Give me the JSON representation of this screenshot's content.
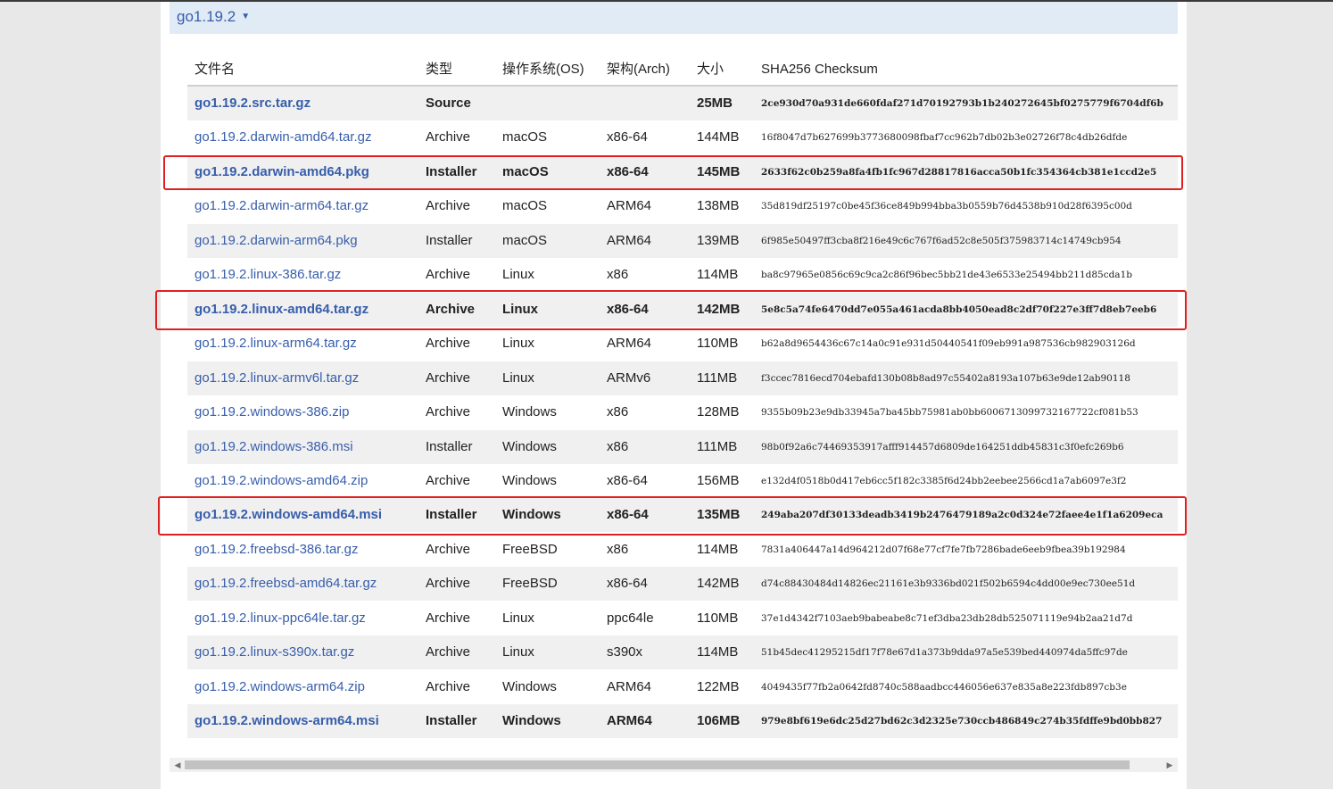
{
  "version": {
    "label": "go1.19.2",
    "caret": "▼"
  },
  "headers": {
    "file": "文件名",
    "type": "类型",
    "os": "操作系统(OS)",
    "arch": "架构(Arch)",
    "size": "大小",
    "checksum": "SHA256 Checksum"
  },
  "rows": [
    {
      "file": "go1.19.2.src.tar.gz",
      "type": "Source",
      "os": "",
      "arch": "",
      "size": "25MB",
      "checksum": "2ce930d70a931de660fdaf271d70192793b1b240272645bf0275779f6704df6b",
      "bold": true
    },
    {
      "file": "go1.19.2.darwin-amd64.tar.gz",
      "type": "Archive",
      "os": "macOS",
      "arch": "x86-64",
      "size": "144MB",
      "checksum": "16f8047d7b627699b3773680098fbaf7cc962b7db02b3e02726f78c4db26dfde",
      "bold": false
    },
    {
      "file": "go1.19.2.darwin-amd64.pkg",
      "type": "Installer",
      "os": "macOS",
      "arch": "x86-64",
      "size": "145MB",
      "checksum": "2633f62c0b259a8fa4fb1fc967d28817816acca50b1fc354364cb381e1ccd2e5",
      "bold": true
    },
    {
      "file": "go1.19.2.darwin-arm64.tar.gz",
      "type": "Archive",
      "os": "macOS",
      "arch": "ARM64",
      "size": "138MB",
      "checksum": "35d819df25197c0be45f36ce849b994bba3b0559b76d4538b910d28f6395c00d",
      "bold": false
    },
    {
      "file": "go1.19.2.darwin-arm64.pkg",
      "type": "Installer",
      "os": "macOS",
      "arch": "ARM64",
      "size": "139MB",
      "checksum": "6f985e50497ff3cba8f216e49c6c767f6ad52c8e505f375983714c14749cb954",
      "bold": false
    },
    {
      "file": "go1.19.2.linux-386.tar.gz",
      "type": "Archive",
      "os": "Linux",
      "arch": "x86",
      "size": "114MB",
      "checksum": "ba8c97965e0856c69c9ca2c86f96bec5bb21de43e6533e25494bb211d85cda1b",
      "bold": false
    },
    {
      "file": "go1.19.2.linux-amd64.tar.gz",
      "type": "Archive",
      "os": "Linux",
      "arch": "x86-64",
      "size": "142MB",
      "checksum": "5e8c5a74fe6470dd7e055a461acda8bb4050ead8c2df70f227e3ff7d8eb7eeb6",
      "bold": true
    },
    {
      "file": "go1.19.2.linux-arm64.tar.gz",
      "type": "Archive",
      "os": "Linux",
      "arch": "ARM64",
      "size": "110MB",
      "checksum": "b62a8d9654436c67c14a0c91e931d50440541f09eb991a987536cb982903126d",
      "bold": false
    },
    {
      "file": "go1.19.2.linux-armv6l.tar.gz",
      "type": "Archive",
      "os": "Linux",
      "arch": "ARMv6",
      "size": "111MB",
      "checksum": "f3ccec7816ecd704ebafd130b08b8ad97c55402a8193a107b63e9de12ab90118",
      "bold": false
    },
    {
      "file": "go1.19.2.windows-386.zip",
      "type": "Archive",
      "os": "Windows",
      "arch": "x86",
      "size": "128MB",
      "checksum": "9355b09b23e9db33945a7ba45bb75981ab0bb6006713099732167722cf081b53",
      "bold": false
    },
    {
      "file": "go1.19.2.windows-386.msi",
      "type": "Installer",
      "os": "Windows",
      "arch": "x86",
      "size": "111MB",
      "checksum": "98b0f92a6c74469353917afff914457d6809de164251ddb45831c3f0efc269b6",
      "bold": false
    },
    {
      "file": "go1.19.2.windows-amd64.zip",
      "type": "Archive",
      "os": "Windows",
      "arch": "x86-64",
      "size": "156MB",
      "checksum": "e132d4f0518b0d417eb6cc5f182c3385f6d24bb2eebee2566cd1a7ab6097e3f2",
      "bold": false
    },
    {
      "file": "go1.19.2.windows-amd64.msi",
      "type": "Installer",
      "os": "Windows",
      "arch": "x86-64",
      "size": "135MB",
      "checksum": "249aba207df30133deadb3419b2476479189a2c0d324e72faee4e1f1a6209eca",
      "bold": true
    },
    {
      "file": "go1.19.2.freebsd-386.tar.gz",
      "type": "Archive",
      "os": "FreeBSD",
      "arch": "x86",
      "size": "114MB",
      "checksum": "7831a406447a14d964212d07f68e77cf7fe7fb7286bade6eeb9fbea39b192984",
      "bold": false
    },
    {
      "file": "go1.19.2.freebsd-amd64.tar.gz",
      "type": "Archive",
      "os": "FreeBSD",
      "arch": "x86-64",
      "size": "142MB",
      "checksum": "d74c88430484d14826ec21161e3b9336bd021f502b6594c4dd00e9ec730ee51d",
      "bold": false
    },
    {
      "file": "go1.19.2.linux-ppc64le.tar.gz",
      "type": "Archive",
      "os": "Linux",
      "arch": "ppc64le",
      "size": "110MB",
      "checksum": "37e1d4342f7103aeb9babeabe8c71ef3dba23db28db525071119e94b2aa21d7d",
      "bold": false
    },
    {
      "file": "go1.19.2.linux-s390x.tar.gz",
      "type": "Archive",
      "os": "Linux",
      "arch": "s390x",
      "size": "114MB",
      "checksum": "51b45dec41295215df17f78e67d1a373b9dda97a5e539bed440974da5ffc97de",
      "bold": false
    },
    {
      "file": "go1.19.2.windows-arm64.zip",
      "type": "Archive",
      "os": "Windows",
      "arch": "ARM64",
      "size": "122MB",
      "checksum": "4049435f77fb2a0642fd8740c588aadbcc446056e637e835a8e223fdb897cb3e",
      "bold": false
    },
    {
      "file": "go1.19.2.windows-arm64.msi",
      "type": "Installer",
      "os": "Windows",
      "arch": "ARM64",
      "size": "106MB",
      "checksum": "979e8bf619e6dc25d27bd62c3d2325e730ccb486849c274b35fdffe9bd0bb827",
      "bold": true
    }
  ],
  "highlight_color": "#e02020",
  "link_color": "#375eab",
  "scrollbar": {
    "left_arrow": "◀",
    "right_arrow": "▶"
  }
}
